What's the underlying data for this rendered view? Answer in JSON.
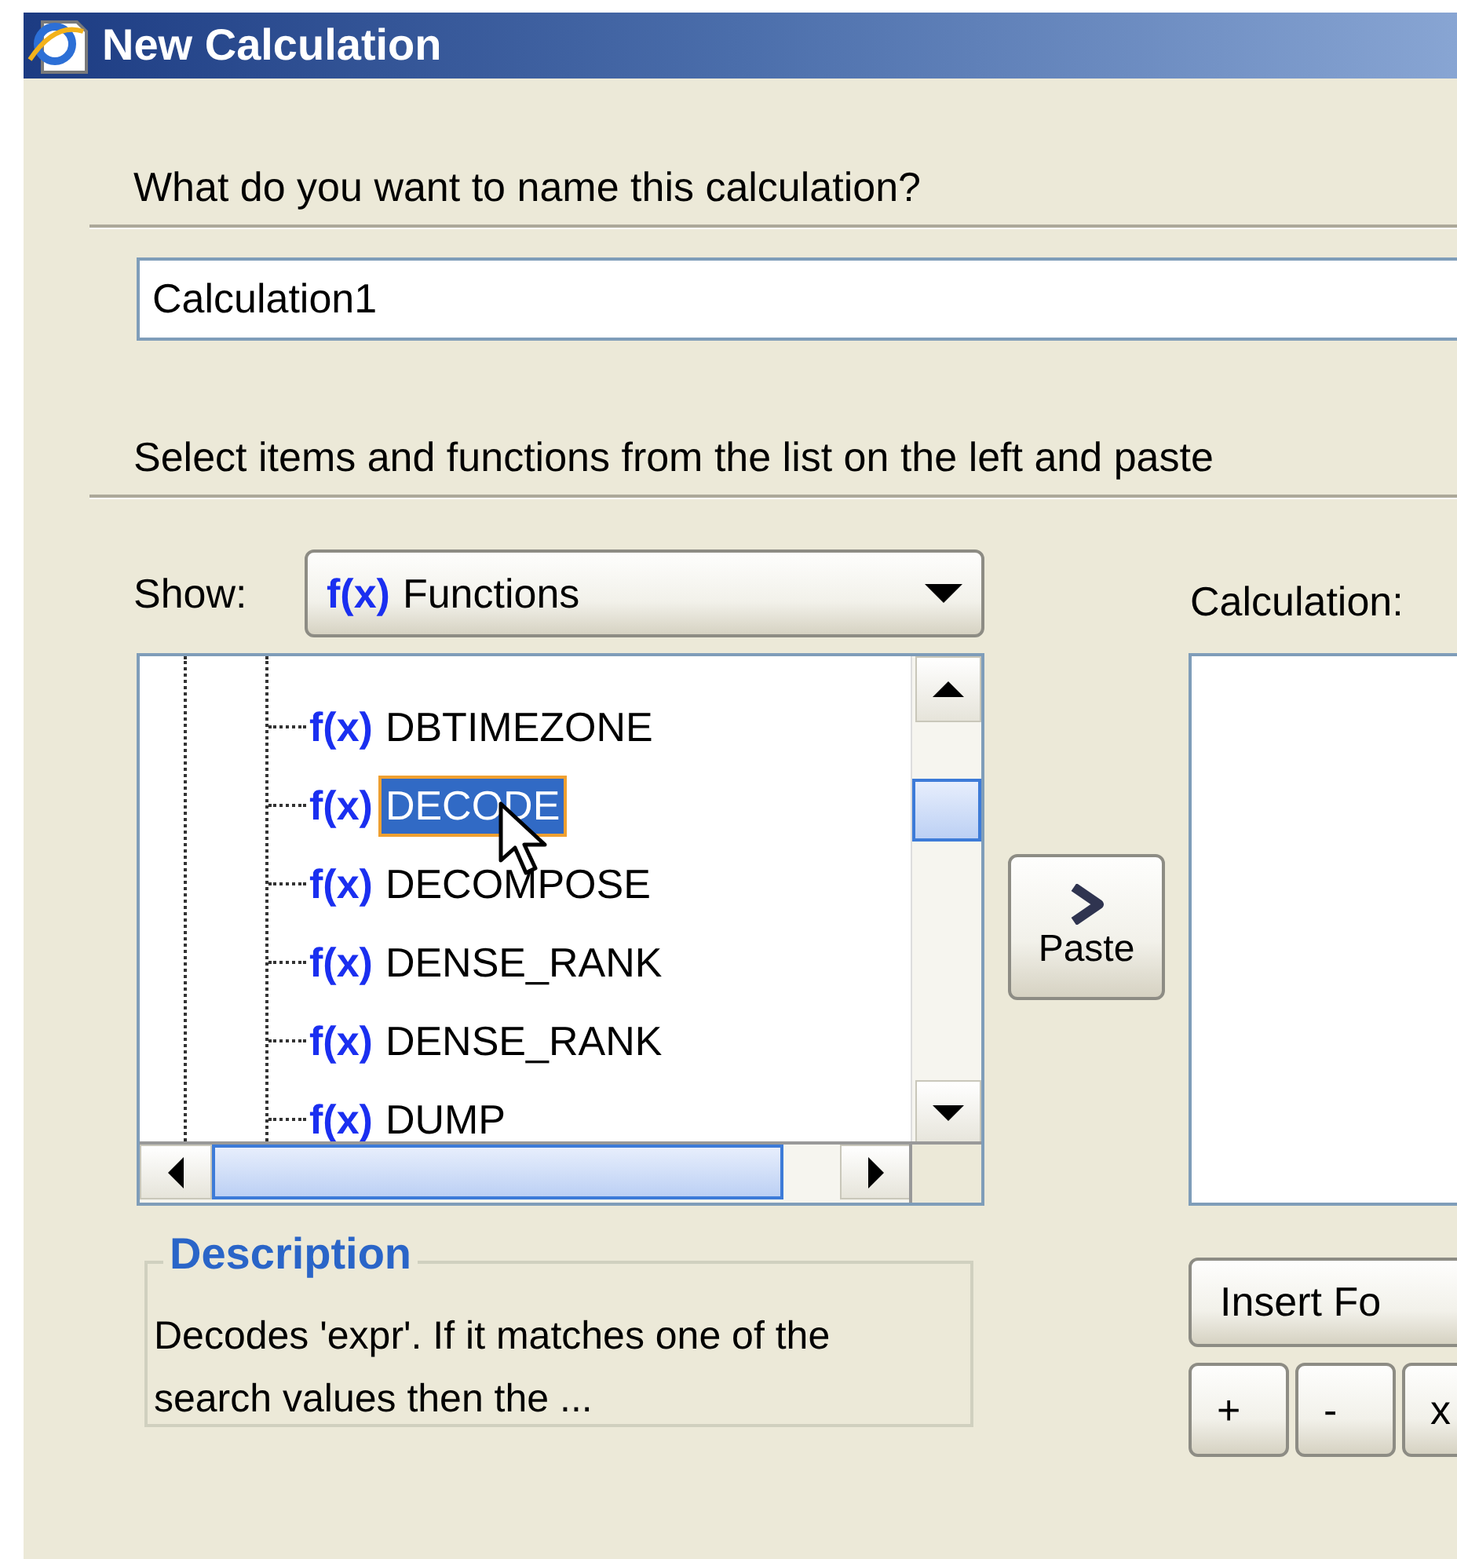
{
  "window": {
    "title": "New Calculation"
  },
  "name_prompt": "What do you want to name this calculation?",
  "name_field": {
    "value": "Calculation1"
  },
  "instruction": "Select items and functions from the list on the left and paste",
  "show": {
    "label": "Show:",
    "dropdown": {
      "icon_text": "f(x)",
      "value": "Functions"
    }
  },
  "tree": {
    "items": [
      {
        "icon_text": "f(x)",
        "label": "DBTIMEZONE",
        "selected": false
      },
      {
        "icon_text": "f(x)",
        "label": "DECODE",
        "selected": true
      },
      {
        "icon_text": "f(x)",
        "label": "DECOMPOSE",
        "selected": false
      },
      {
        "icon_text": "f(x)",
        "label": "DENSE_RANK",
        "selected": false
      },
      {
        "icon_text": "f(x)",
        "label": "DENSE_RANK",
        "selected": false
      },
      {
        "icon_text": "f(x)",
        "label": "DUMP",
        "selected": false
      }
    ]
  },
  "paste_button": {
    "label": "Paste"
  },
  "calculation": {
    "label": "Calculation:"
  },
  "description": {
    "title": "Description",
    "text": "Decodes 'expr'. If it matches one of the search values then the ..."
  },
  "insert_button": {
    "label": "Insert Fo"
  },
  "operator_buttons": [
    "+",
    "-",
    "x"
  ]
}
